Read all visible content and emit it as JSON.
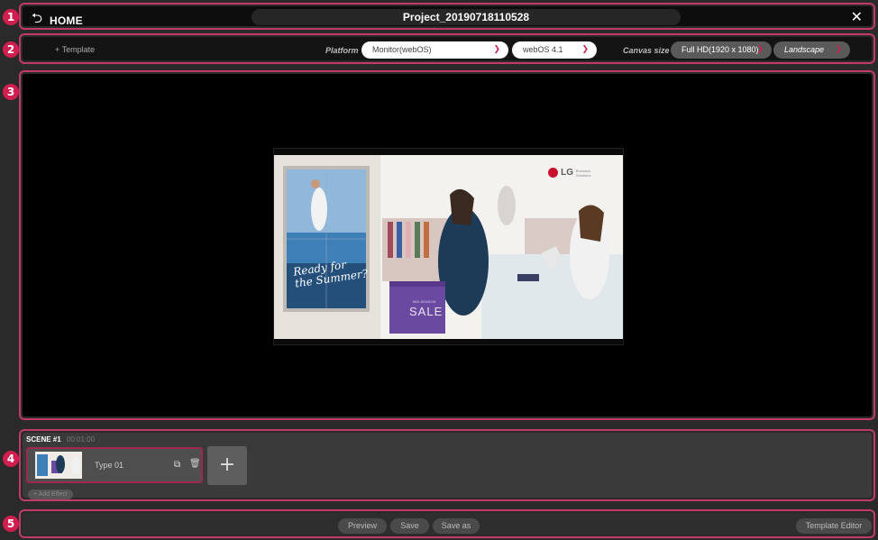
{
  "badges": [
    "❶",
    "❷",
    "❸",
    "❹",
    "❺"
  ],
  "header": {
    "home_label": "HOME",
    "project_title": "Project_20190718110528"
  },
  "options": {
    "template_link": "+ Template",
    "platform_label": "Platform",
    "platform_value": "Monitor(webOS)",
    "os_value": "webOS 4.1",
    "canvas_size_label": "Canvas size",
    "resolution_value": "Full HD(1920 x 1080)",
    "orientation_value": "Landscape"
  },
  "preview": {
    "brand": "LG",
    "brand_sub": "Business Solutions",
    "poster_text_line1": "Ready for",
    "poster_text_line2": "the Summer?",
    "bag_small_text": "MID-SEASON",
    "bag_text": "SALE"
  },
  "timeline": {
    "scene_name": "SCENE #1",
    "scene_time": "00:01:00",
    "scene_type": "Type 01",
    "add_effect": "+ Add Effect"
  },
  "footer": {
    "preview": "Preview",
    "save": "Save",
    "save_as": "Save as",
    "template_editor": "Template Editor"
  },
  "colors": {
    "accent": "#cf1f4e",
    "panel_border": "#c13a6a",
    "background": "#2a2a2a"
  }
}
